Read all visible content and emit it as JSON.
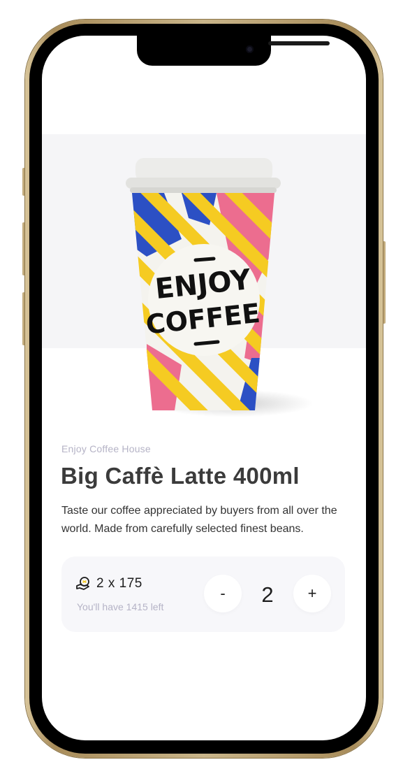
{
  "product": {
    "image_alt": "Coffee cup with ENJOY COFFEE print",
    "cup_lettering": [
      "ENJOY",
      "COFFEE"
    ],
    "store_name": "Enjoy Coffee House",
    "title": "Big Caffè Latte 400ml",
    "description": "Taste our coffee appreciated by buyers from all over the world. Made from carefully selected finest beans."
  },
  "purchase": {
    "price_icon": "coin-hand-icon",
    "price_text": "2 x 175",
    "balance_text": "You'll have 1415 left",
    "decrement_label": "-",
    "quantity": "2",
    "increment_label": "+"
  },
  "colors": {
    "accent_yellow": "#f5cb22",
    "accent_blue": "#2c50c4",
    "accent_pink": "#ec6d8f",
    "muted_text": "#b5b3c6",
    "card_bg": "#f7f7fa"
  }
}
